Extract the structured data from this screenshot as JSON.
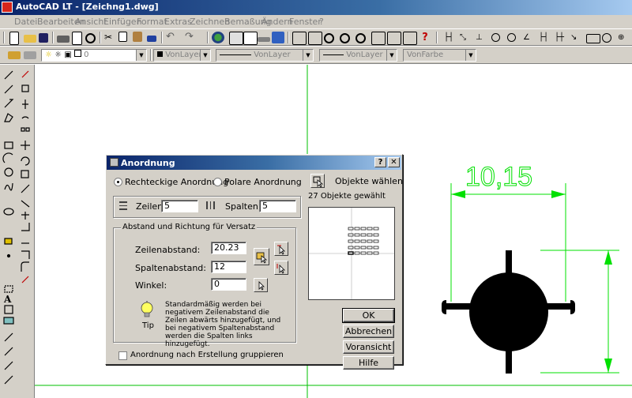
{
  "window": {
    "title": "AutoCAD LT - [Zeichng1.dwg]"
  },
  "menu": [
    "Datei",
    "Bearbeiten",
    "Ansicht",
    "Einfügen",
    "Format",
    "Extras",
    "Zeichnen",
    "Bemaßung",
    "Ändern",
    "Fenster",
    "?"
  ],
  "layer_toolbar": {
    "layer_value": "0",
    "color_value": "VonLayer",
    "linetype_value": "VonLayer",
    "lineweight_value": "VonLayer",
    "plotstyle_value": "VonFarbe"
  },
  "drawing": {
    "dimension_text": "10,15",
    "colors": {
      "dimension": "#00e000",
      "axis": "#00c000",
      "part": "#000000"
    }
  },
  "dialog": {
    "title": "Anordnung",
    "help_button": "?",
    "close_button": "✕",
    "radio_rect": "Rechteckige Anordnung",
    "radio_polar": "Polare Anordnung",
    "rect_selected": true,
    "select_objects": "Objekte wählen",
    "selected_count": "27 Objekte gewählt",
    "rows_label": "Zeilen:",
    "rows_value": "5",
    "cols_label": "Spalten:",
    "cols_value": "5",
    "group_title": "Abstand und Richtung für Versatz",
    "row_offset_label": "Zeilenabstand:",
    "row_offset_value": "20.23",
    "col_offset_label": "Spaltenabstand:",
    "col_offset_value": "12",
    "angle_label": "Winkel:",
    "angle_value": "0",
    "tip_label": "Tip",
    "tip_text": "Standardmäßig werden bei negativem Zeilenabstand die Zeilen abwärts hinzugefügt, und bei negativem Spaltenabstand werden die Spalten links hinzugefügt.",
    "group_checkbox": "Anordnung nach Erstellung gruppieren",
    "ok": "OK",
    "cancel": "Abbrechen",
    "preview": "Voransicht <",
    "help": "Hilfe"
  }
}
